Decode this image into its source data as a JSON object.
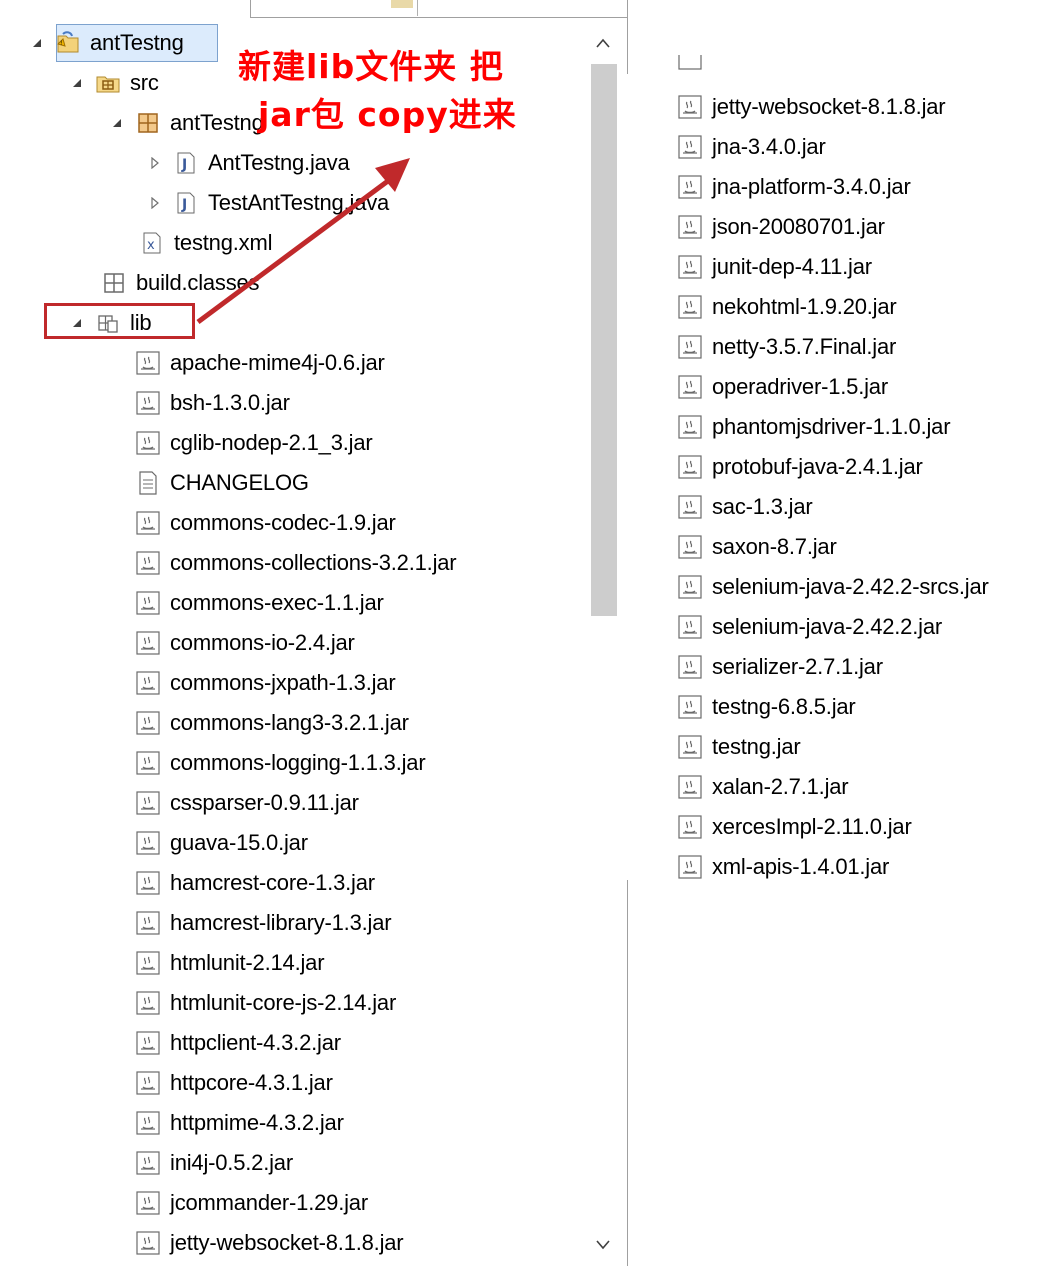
{
  "annotation": {
    "line1": "新建lib文件夹 把",
    "line2": "jar包 copy进来"
  },
  "tree": {
    "root": "antTestng",
    "src": "src",
    "package": "antTestng",
    "files": [
      "AntTestng.java",
      "TestAntTestng.java"
    ],
    "testng_xml": "testng.xml",
    "build_classes": "build.classes",
    "lib": "lib",
    "lib_items": [
      "apache-mime4j-0.6.jar",
      "bsh-1.3.0.jar",
      "cglib-nodep-2.1_3.jar",
      "CHANGELOG",
      "commons-codec-1.9.jar",
      "commons-collections-3.2.1.jar",
      "commons-exec-1.1.jar",
      "commons-io-2.4.jar",
      "commons-jxpath-1.3.jar",
      "commons-lang3-3.2.1.jar",
      "commons-logging-1.1.3.jar",
      "cssparser-0.9.11.jar",
      "guava-15.0.jar",
      "hamcrest-core-1.3.jar",
      "hamcrest-library-1.3.jar",
      "htmlunit-2.14.jar",
      "htmlunit-core-js-2.14.jar",
      "httpclient-4.3.2.jar",
      "httpcore-4.3.1.jar",
      "httpmime-4.3.2.jar",
      "ini4j-0.5.2.jar",
      "jcommander-1.29.jar",
      "jetty-websocket-8.1.8.jar"
    ]
  },
  "right_list": [
    "jetty-websocket-8.1.8.jar",
    "jna-3.4.0.jar",
    "jna-platform-3.4.0.jar",
    "json-20080701.jar",
    "junit-dep-4.11.jar",
    "nekohtml-1.9.20.jar",
    "netty-3.5.7.Final.jar",
    "operadriver-1.5.jar",
    "phantomjsdriver-1.1.0.jar",
    "protobuf-java-2.4.1.jar",
    "sac-1.3.jar",
    "saxon-8.7.jar",
    "selenium-java-2.42.2-srcs.jar",
    "selenium-java-2.42.2.jar",
    "serializer-2.7.1.jar",
    "testng-6.8.5.jar",
    "testng.jar",
    "xalan-2.7.1.jar",
    "xercesImpl-2.11.0.jar",
    "xml-apis-1.4.01.jar"
  ],
  "colors": {
    "annotation": "#ff0000",
    "highlight_box": "#c0292b",
    "selection": "#dcebfc"
  }
}
